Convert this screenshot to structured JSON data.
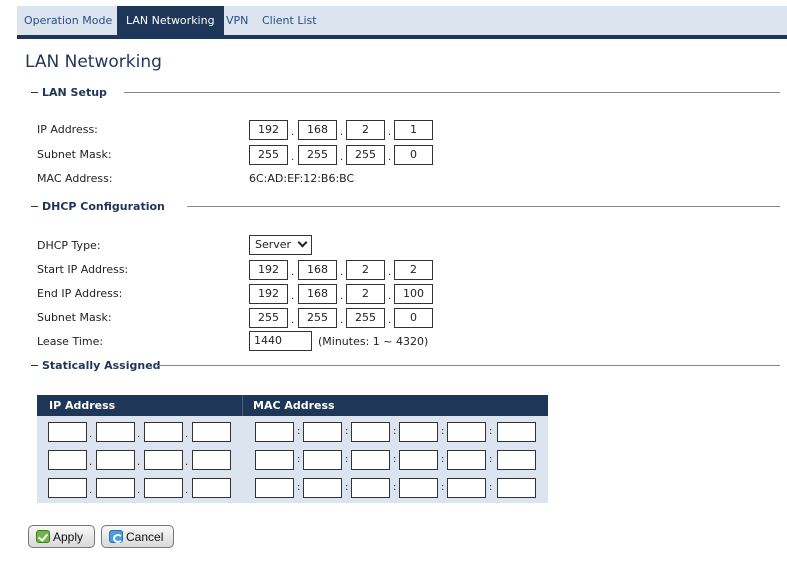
{
  "tabs": [
    "Operation Mode",
    "LAN Networking",
    "VPN",
    "Client List"
  ],
  "active_tab": "LAN Networking",
  "page_title": "LAN Networking",
  "lan_setup": {
    "legend": "LAN Setup",
    "ip_label": "IP Address:",
    "ip": [
      "192",
      "168",
      "2",
      "1"
    ],
    "mask_label": "Subnet Mask:",
    "mask": [
      "255",
      "255",
      "255",
      "0"
    ],
    "mac_label": "MAC Address:",
    "mac": "6C:AD:EF:12:B6:BC"
  },
  "dhcp": {
    "legend": "DHCP Configuration",
    "type_label": "DHCP Type:",
    "type_value": "Server",
    "start_label": "Start IP Address:",
    "start": [
      "192",
      "168",
      "2",
      "2"
    ],
    "end_label": "End IP Address:",
    "end": [
      "192",
      "168",
      "2",
      "100"
    ],
    "mask_label": "Subnet Mask:",
    "mask": [
      "255",
      "255",
      "255",
      "0"
    ],
    "lease_label": "Lease Time:",
    "lease_value": "1440",
    "lease_hint": "(Minutes: 1 ~ 4320)"
  },
  "static": {
    "legend": "Statically Assigned",
    "col_ip": "IP Address",
    "col_mac": "MAC Address"
  },
  "buttons": {
    "apply": "Apply",
    "cancel": "Cancel"
  },
  "colors": {
    "accent": "#1e3658",
    "tab_bar": "#dbe4ef",
    "link": "#2a4d86"
  }
}
